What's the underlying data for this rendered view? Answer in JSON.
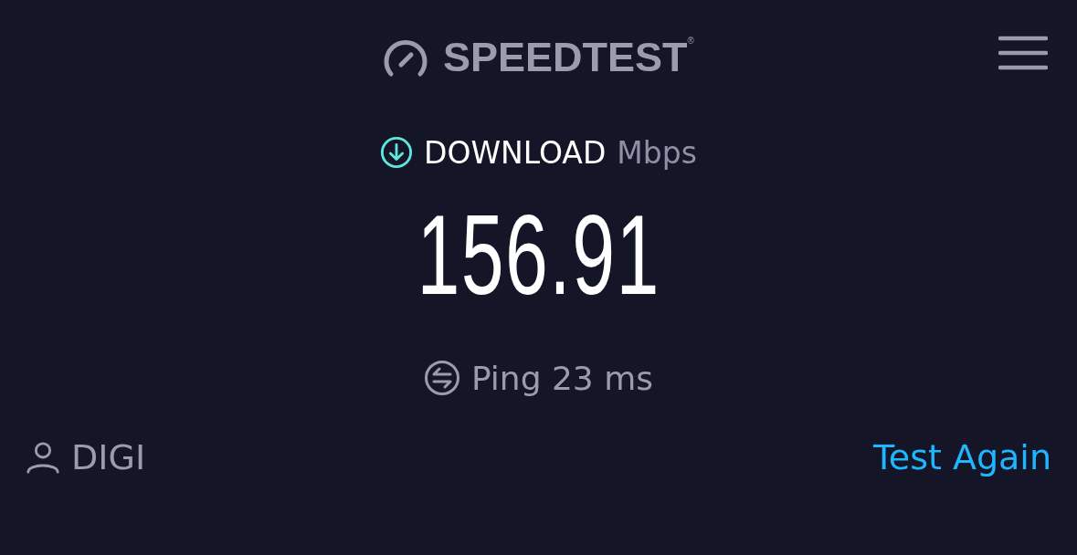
{
  "header": {
    "logo": "SPEEDTEST$^{®}$"
  },
  "result": {
    "kind": "download",
    "label": "DOWNLOAD",
    "unit": "Mbps",
    "value": "156.91"
  },
  "ping": {
    "label": "Ping 23 ms"
  },
  "footer": {
    "provider": "DIGI",
    "action": "Test Again"
  }
}
